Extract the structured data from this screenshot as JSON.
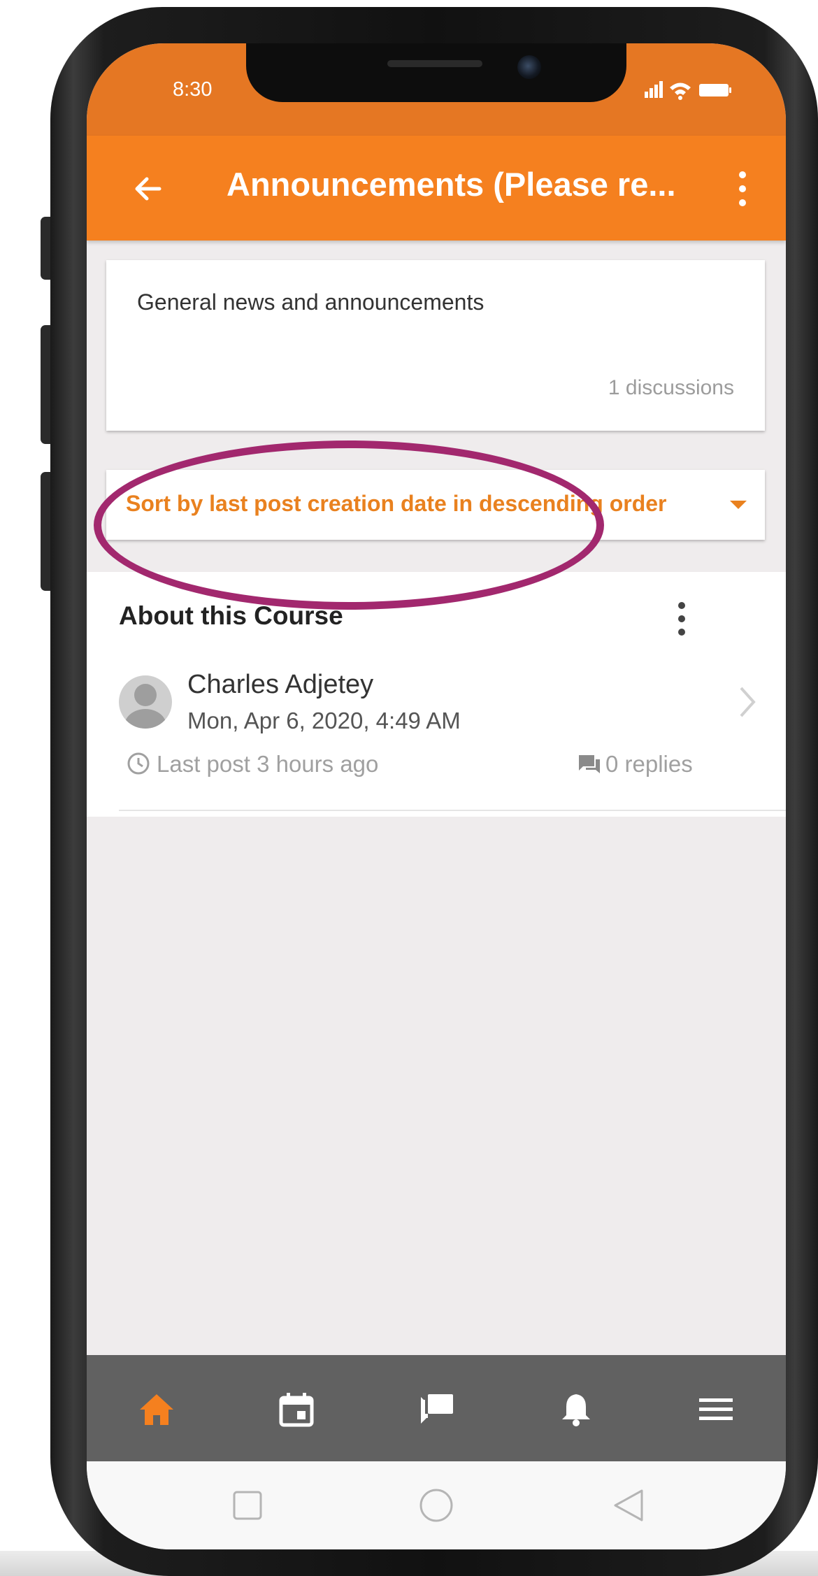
{
  "status_bar": {
    "time": "8:30",
    "icons": [
      "signal-icon",
      "wifi-icon",
      "battery-icon"
    ]
  },
  "app_bar": {
    "title": "Announcements (Please re...",
    "back_icon": "arrow-back-icon",
    "menu_icon": "more-vertical-icon"
  },
  "forum_info": {
    "description": "General news and announcements",
    "discussion_count": "1 discussions"
  },
  "sort": {
    "selected": "Sort by last post creation date in descending order"
  },
  "discussion": {
    "title": "About this Course",
    "author": "Charles Adjetey",
    "date": "Mon, Apr 6, 2020, 4:49 AM",
    "last_post": "Last post 3 hours ago",
    "replies": "0 replies"
  },
  "bottom_nav": [
    {
      "icon": "home-icon",
      "active": true
    },
    {
      "icon": "calendar-icon",
      "active": false
    },
    {
      "icon": "messages-icon",
      "active": false
    },
    {
      "icon": "bell-icon",
      "active": false
    },
    {
      "icon": "menu-icon",
      "active": false
    }
  ],
  "system_nav": [
    "recent-apps-button",
    "home-button",
    "back-button"
  ],
  "colors": {
    "accent": "#f5801f",
    "status_bar": "#e57723",
    "highlight": "#a2286e",
    "bottom_nav": "#616161"
  }
}
